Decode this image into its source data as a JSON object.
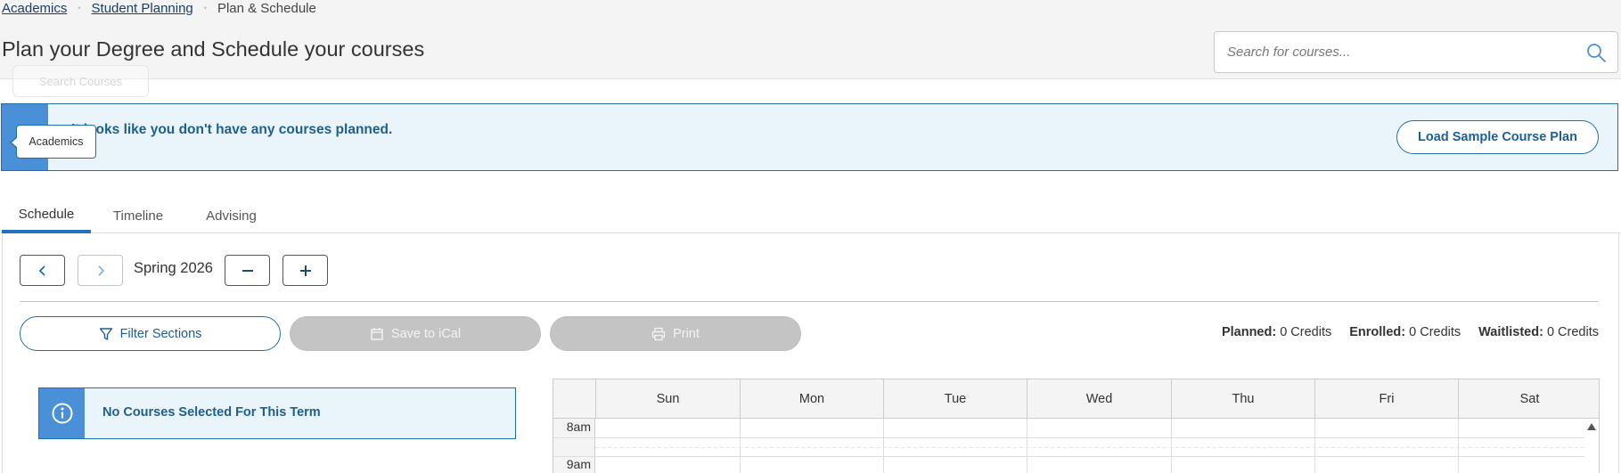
{
  "breadcrumb": {
    "items": [
      {
        "label": "Academics"
      },
      {
        "label": "Student Planning"
      },
      {
        "label": "Plan & Schedule"
      }
    ],
    "separator": "•"
  },
  "header": {
    "title": "Plan your Degree and Schedule your courses",
    "ghost_label": "Search Courses"
  },
  "search": {
    "placeholder": "Search for courses...",
    "icon": "search-icon"
  },
  "notice": {
    "message": "It looks like you don't have any courses planned.",
    "action_label": "Load Sample Course Plan",
    "accent_color": "#4a90d9"
  },
  "tooltip": {
    "text": "Academics"
  },
  "tabs": [
    {
      "label": "Schedule",
      "active": true
    },
    {
      "label": "Timeline",
      "active": false
    },
    {
      "label": "Advising",
      "active": false
    }
  ],
  "term": {
    "label": "Spring 2026",
    "prev_icon": "chevron-left-icon",
    "next_icon": "chevron-right-icon",
    "remove_icon": "minus-icon",
    "add_icon": "plus-icon"
  },
  "actions": {
    "filter_label": "Filter Sections",
    "save_ical_label": "Save to iCal",
    "print_label": "Print"
  },
  "credits": {
    "planned_label": "Planned:",
    "planned_value": "0 Credits",
    "enrolled_label": "Enrolled:",
    "enrolled_value": "0 Credits",
    "waitlisted_label": "Waitlisted:",
    "waitlisted_value": "0 Credits"
  },
  "no_courses": {
    "message": "No Courses Selected For This Term",
    "icon": "info-icon"
  },
  "calendar": {
    "days": [
      "Sun",
      "Mon",
      "Tue",
      "Wed",
      "Thu",
      "Fri",
      "Sat"
    ],
    "times": [
      "8am",
      "9am"
    ]
  },
  "colors": {
    "primary": "#1f6fa6",
    "tab_active": "#2570c0",
    "disabled": "#c4c4c4"
  }
}
